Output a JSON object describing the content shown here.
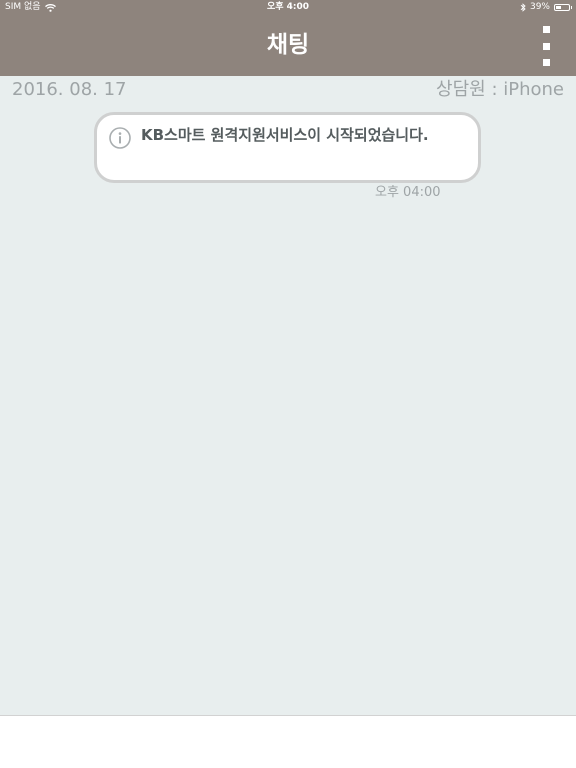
{
  "status_bar": {
    "carrier": "SIM 없음",
    "time": "오후 4:00",
    "battery_percent": "39%",
    "battery_level": 0.39
  },
  "nav": {
    "title": "채팅"
  },
  "chat": {
    "date": "2016. 08. 17",
    "agent": "상담원 : iPhone",
    "messages": [
      {
        "text": "KB스마트 원격지원서비스이 시작되었습니다.",
        "time": "오후 04:00",
        "icon": "info-icon"
      }
    ]
  },
  "colors": {
    "header": "#8e847d",
    "background": "#e8eeee",
    "bubble_border": "#cfd0d0",
    "muted_text": "#9ea4a6",
    "message_text": "#555c5e"
  }
}
